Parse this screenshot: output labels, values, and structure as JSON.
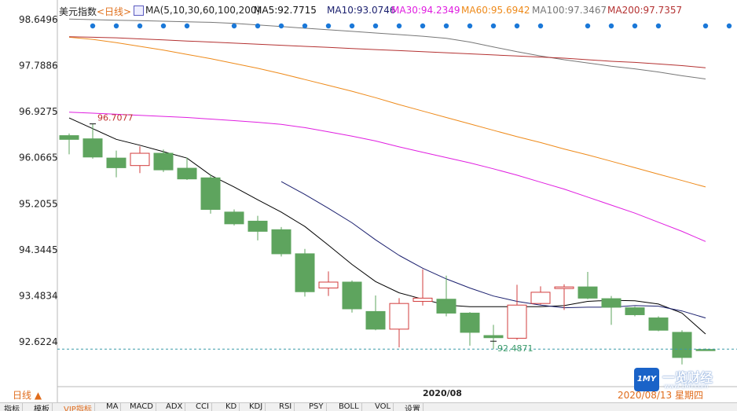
{
  "header": {
    "title": "美元指数",
    "period": "<日线>",
    "ma_label": "MA(5,10,30,60,100,200)",
    "ma5": "MA5:92.7715",
    "ma10": "MA10:93.0746",
    "ma30": "MA30:94.2349",
    "ma60": "MA60:95.6942",
    "ma100": "MA100:97.3467",
    "ma200": "MA200:97.7357"
  },
  "colors": {
    "up": "#d23c3c",
    "down": "#5ea45e",
    "ma5": "#000000",
    "ma10": "#1a1f6e",
    "ma30": "#e01ee0",
    "ma60": "#ee8a1a",
    "ma100": "#777777",
    "ma200": "#b43232"
  },
  "footer": {
    "period_button": "日线 ▲",
    "date_label": "2020/08",
    "cursor_date": "2020/08/13 星期四"
  },
  "tabs": [
    "指标",
    "模板",
    "VIP指标",
    "MA",
    "MACD",
    "ADX",
    "CCI",
    "KD",
    "KDJ",
    "RSI",
    "PSY",
    "BOLL",
    "VOL",
    "设置"
  ],
  "annotations": {
    "high": "96.7077",
    "low": "92.4871"
  },
  "logo": {
    "mark": "1MY",
    "text": "一览财经",
    "url": "www.1MY.com"
  },
  "chart_data": {
    "type": "candlestick",
    "title": "美元指数",
    "y_ticks": [
      98.6496,
      97.7886,
      96.9275,
      96.0665,
      95.2055,
      94.3445,
      93.4834,
      92.6224
    ],
    "ylim": [
      92.3,
      98.75
    ],
    "grid": false,
    "reference_line": 92.4871,
    "candles": [
      {
        "o": 96.48,
        "c": 96.41,
        "h": 96.52,
        "l": 96.13
      },
      {
        "o": 96.42,
        "c": 96.08,
        "h": 96.7,
        "l": 96.05
      },
      {
        "o": 96.06,
        "c": 95.88,
        "h": 96.2,
        "l": 95.7
      },
      {
        "o": 95.92,
        "c": 96.15,
        "h": 96.28,
        "l": 95.78
      },
      {
        "o": 96.15,
        "c": 95.84,
        "h": 96.22,
        "l": 95.8
      },
      {
        "o": 95.87,
        "c": 95.67,
        "h": 96.07,
        "l": 95.65
      },
      {
        "o": 95.69,
        "c": 95.1,
        "h": 95.76,
        "l": 95.02
      },
      {
        "o": 95.05,
        "c": 94.83,
        "h": 95.1,
        "l": 94.8
      },
      {
        "o": 94.88,
        "c": 94.69,
        "h": 94.98,
        "l": 94.52
      },
      {
        "o": 94.72,
        "c": 94.27,
        "h": 94.77,
        "l": 94.22
      },
      {
        "o": 94.27,
        "c": 93.56,
        "h": 94.36,
        "l": 93.47
      },
      {
        "o": 93.63,
        "c": 93.74,
        "h": 93.94,
        "l": 93.48
      },
      {
        "o": 93.74,
        "c": 93.24,
        "h": 93.77,
        "l": 93.17
      },
      {
        "o": 93.19,
        "c": 92.86,
        "h": 93.49,
        "l": 92.84
      },
      {
        "o": 92.86,
        "c": 93.34,
        "h": 93.44,
        "l": 92.52
      },
      {
        "o": 93.38,
        "c": 93.44,
        "h": 93.98,
        "l": 93.3
      },
      {
        "o": 93.42,
        "c": 93.16,
        "h": 93.86,
        "l": 93.1
      },
      {
        "o": 93.16,
        "c": 92.8,
        "h": 93.18,
        "l": 92.55
      },
      {
        "o": 92.74,
        "c": 92.7,
        "h": 92.94,
        "l": 92.49
      },
      {
        "o": 92.69,
        "c": 93.31,
        "h": 93.69,
        "l": 92.66
      },
      {
        "o": 93.34,
        "c": 93.55,
        "h": 93.66,
        "l": 93.32
      },
      {
        "o": 93.62,
        "c": 93.65,
        "h": 93.7,
        "l": 93.22
      },
      {
        "o": 93.65,
        "c": 93.44,
        "h": 93.93,
        "l": 93.42
      },
      {
        "o": 93.43,
        "c": 93.27,
        "h": 93.48,
        "l": 92.94
      },
      {
        "o": 93.26,
        "c": 93.13,
        "h": 93.28,
        "l": 93.1
      },
      {
        "o": 93.07,
        "c": 92.84,
        "h": 93.1,
        "l": 92.82
      },
      {
        "o": 92.8,
        "c": 92.33,
        "h": 92.84,
        "l": 92.2
      },
      {
        "o": 92.48,
        "c": 92.48,
        "h": 92.5,
        "l": 92.46
      }
    ],
    "ma": [
      {
        "name": "MA5",
        "values": [
          96.81,
          96.61,
          96.41,
          96.3,
          96.18,
          96.06,
          95.74,
          95.52,
          95.28,
          95.05,
          94.78,
          94.43,
          94.07,
          93.75,
          93.54,
          93.42,
          93.31,
          93.28,
          93.28,
          93.28,
          93.28,
          93.3,
          93.38,
          93.4,
          93.39,
          93.33,
          93.16,
          92.77
        ]
      },
      {
        "name": "MA10",
        "values": [
          null,
          null,
          null,
          null,
          null,
          null,
          null,
          null,
          null,
          95.62,
          95.38,
          95.12,
          94.85,
          94.53,
          94.24,
          94.0,
          93.8,
          93.63,
          93.48,
          93.38,
          93.31,
          93.26,
          93.27,
          93.27,
          93.3,
          93.29,
          93.2,
          93.07
        ]
      },
      {
        "name": "MA30",
        "values": [
          96.92,
          96.9,
          96.88,
          96.86,
          96.84,
          96.82,
          96.79,
          96.76,
          96.73,
          96.69,
          96.63,
          96.55,
          96.47,
          96.38,
          96.27,
          96.17,
          96.07,
          95.97,
          95.86,
          95.74,
          95.61,
          95.48,
          95.33,
          95.18,
          95.03,
          94.86,
          94.69,
          94.5
        ]
      },
      {
        "name": "MA60",
        "values": [
          98.32,
          98.28,
          98.22,
          98.15,
          98.08,
          98.0,
          97.92,
          97.83,
          97.74,
          97.64,
          97.53,
          97.42,
          97.31,
          97.19,
          97.06,
          96.94,
          96.82,
          96.7,
          96.58,
          96.46,
          96.35,
          96.23,
          96.12,
          96.0,
          95.88,
          95.76,
          95.64,
          95.52
        ]
      },
      {
        "name": "MA100",
        "values": [
          98.66,
          98.65,
          98.64,
          98.63,
          98.62,
          98.61,
          98.6,
          98.58,
          98.55,
          98.52,
          98.49,
          98.46,
          98.43,
          98.4,
          98.37,
          98.34,
          98.3,
          98.23,
          98.14,
          98.05,
          97.97,
          97.9,
          97.84,
          97.78,
          97.73,
          97.67,
          97.6,
          97.54
        ]
      },
      {
        "name": "MA200",
        "values": [
          98.33,
          98.32,
          98.31,
          98.29,
          98.27,
          98.25,
          98.23,
          98.21,
          98.19,
          98.17,
          98.15,
          98.13,
          98.11,
          98.09,
          98.07,
          98.05,
          98.03,
          98.01,
          97.99,
          97.97,
          97.95,
          97.93,
          97.9,
          97.87,
          97.85,
          97.82,
          97.79,
          97.75
        ]
      }
    ],
    "signal_dots": [
      1,
      2,
      3,
      4,
      5,
      7,
      8,
      9,
      10,
      11,
      12,
      13,
      14,
      15,
      16,
      17,
      18,
      19,
      20,
      22,
      23,
      24,
      25,
      27,
      28
    ]
  }
}
